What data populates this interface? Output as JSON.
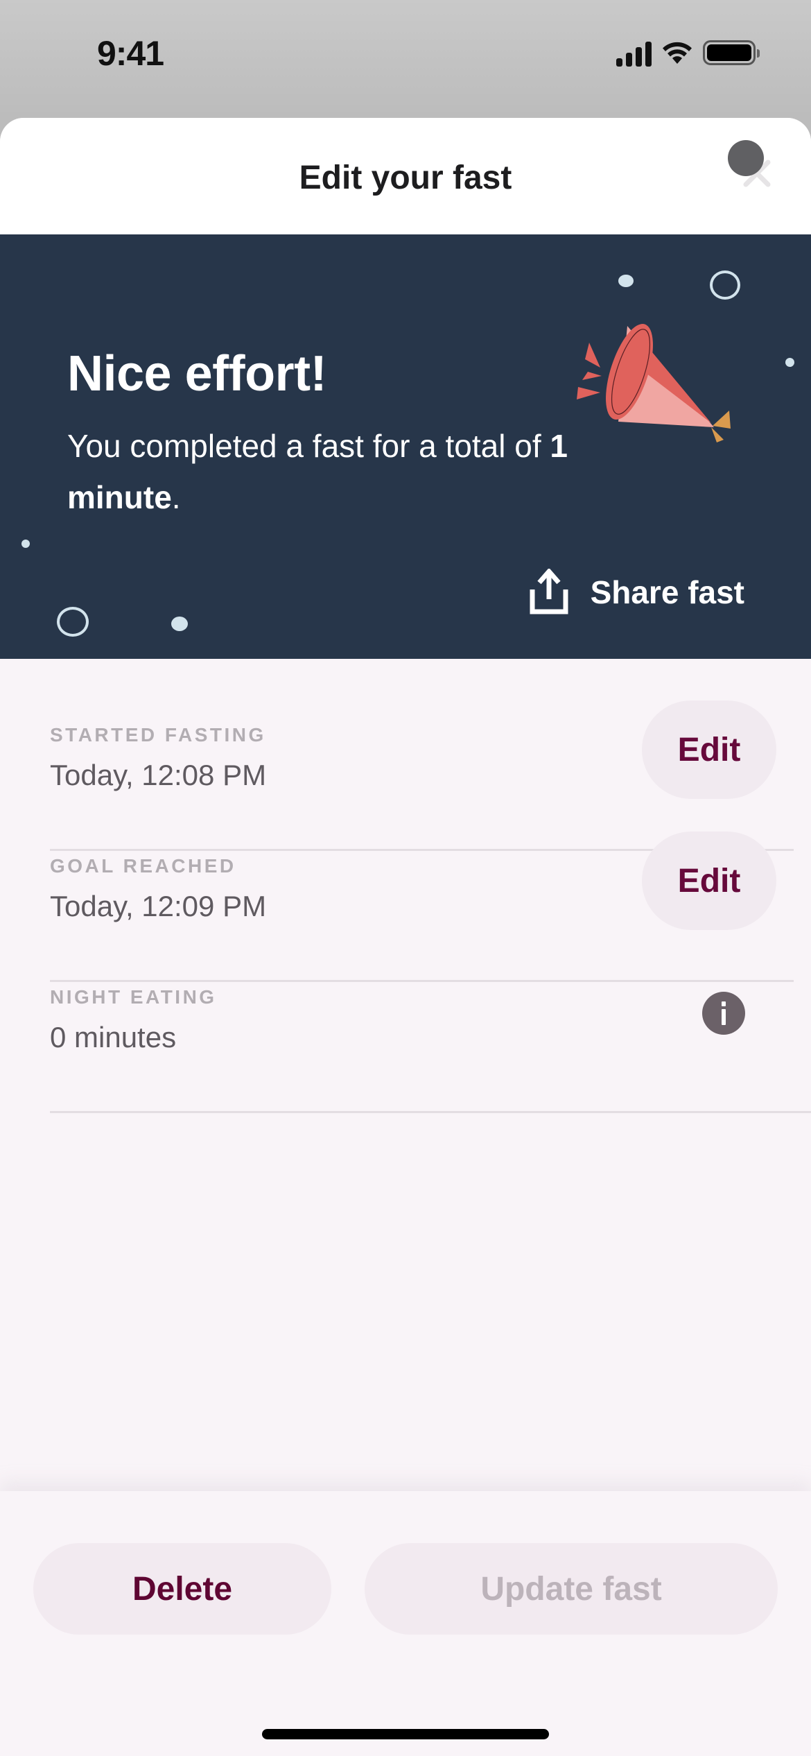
{
  "status_bar": {
    "time": "9:41",
    "icons": [
      "cellular-signal-icon",
      "wifi-icon",
      "battery-icon"
    ]
  },
  "header": {
    "title": "Edit your fast",
    "close_icon": "close-icon"
  },
  "banner": {
    "title": "Nice effort!",
    "message_prefix": "You completed a fast for a total of ",
    "message_bold": "1 minute",
    "message_suffix": ".",
    "share_label": "Share fast",
    "share_icon": "share-icon",
    "illustration": "party-popper-icon",
    "colors": {
      "background": "#27364a",
      "confetti": "#d2e3ec",
      "horn_dark": "#e0625c",
      "horn_light": "#f0a6a2",
      "ribbon": "#d99a4e"
    }
  },
  "rows": [
    {
      "label": "STARTED FASTING",
      "value": "Today, 12:08 PM",
      "action": "Edit"
    },
    {
      "label": "GOAL REACHED",
      "value": "Today, 12:09 PM",
      "action": "Edit"
    },
    {
      "label": "NIGHT EATING",
      "value": "0 minutes",
      "action_icon": "info-icon"
    }
  ],
  "footer": {
    "delete_label": "Delete",
    "update_label": "Update fast",
    "update_enabled": false
  },
  "colors": {
    "accent": "#66093b",
    "sheet_background": "#f9f4f8",
    "button_background": "#f2eaf0",
    "disabled_text": "#bcb3ba"
  }
}
